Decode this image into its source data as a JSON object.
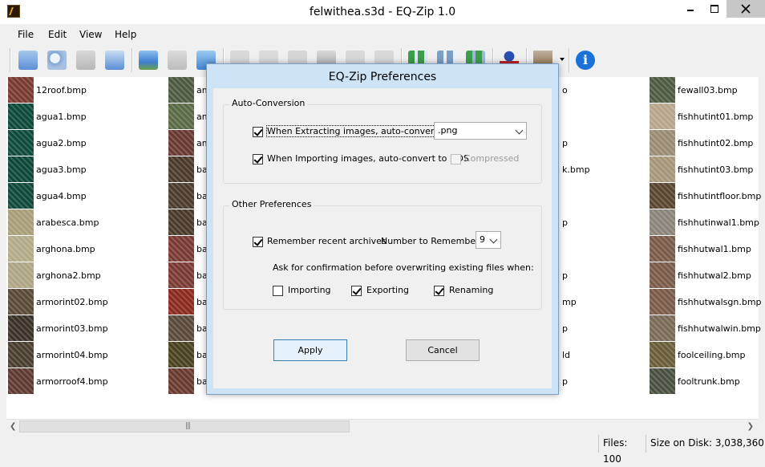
{
  "window": {
    "title": "felwithea.s3d - EQ-Zip 1.0",
    "controls": {
      "minimize_icon": "minimize-icon",
      "maximize_icon": "maximize-icon",
      "close_icon": "close-icon"
    }
  },
  "menu": {
    "items": [
      {
        "label": "File",
        "mnemonic": "F"
      },
      {
        "label": "Edit",
        "mnemonic": "E"
      },
      {
        "label": "View",
        "mnemonic": "V"
      },
      {
        "label": "Help",
        "mnemonic": "H"
      }
    ]
  },
  "toolbar": {
    "buttons": [
      {
        "icon": "new-archive-icon",
        "color": "#5b8fd6"
      },
      {
        "icon": "open-archive-icon",
        "color": "#7fa6d8"
      },
      {
        "icon": "save-archive-icon",
        "color": "#b8b8b8"
      },
      {
        "icon": "save-as-icon",
        "color": "#5b8fd6"
      },
      {
        "icon": "import-images-icon",
        "color": "#3f7fcf"
      },
      {
        "icon": "extract-images-icon",
        "color": "#bcbcbc"
      },
      {
        "icon": "extract-all-icon",
        "color": "#3f86d6"
      },
      {
        "icon": "cut-icon",
        "color": "#c8c8c8"
      },
      {
        "icon": "copy-icon",
        "color": "#c8c8c8"
      },
      {
        "icon": "paste-icon",
        "color": "#c8c8c8"
      },
      {
        "icon": "delete-icon",
        "color": "#b8b8b8"
      },
      {
        "icon": "rename-icon",
        "color": "#c8c8c8"
      },
      {
        "icon": "properties-icon",
        "color": "#c8c8c8"
      },
      {
        "icon": "select-all-icon",
        "color": "#3c9e4a"
      },
      {
        "icon": "select-none-icon",
        "color": "#7aa0c8"
      },
      {
        "icon": "invert-selection-icon",
        "color": "#3c9e4a"
      },
      {
        "icon": "preferences-icon",
        "color": "#2a4fb0"
      },
      {
        "icon": "thumbnail-size-icon",
        "color": "#8a6a40"
      },
      {
        "icon": "about-icon",
        "color": "#1a72d8"
      }
    ]
  },
  "files": {
    "column1": [
      {
        "name": "12roof.bmp",
        "color": "#7a3a32"
      },
      {
        "name": "agua1.bmp",
        "color": "#0e4a3a"
      },
      {
        "name": "agua2.bmp",
        "color": "#0f4b3c"
      },
      {
        "name": "agua3.bmp",
        "color": "#0d4838"
      },
      {
        "name": "agua4.bmp",
        "color": "#0f4a3b"
      },
      {
        "name": "arabesca.bmp",
        "color": "#a89e7a"
      },
      {
        "name": "arghona.bmp",
        "color": "#b3aa88"
      },
      {
        "name": "arghona2.bmp",
        "color": "#aea585"
      },
      {
        "name": "armorint02.bmp",
        "color": "#5a4a38"
      },
      {
        "name": "armorint03.bmp",
        "color": "#3a3128"
      },
      {
        "name": "armorint04.bmp",
        "color": "#4a3e30"
      },
      {
        "name": "armorroof4.bmp",
        "color": "#5e3a30"
      }
    ],
    "column2": [
      {
        "name": "am",
        "color": "#4e5a40"
      },
      {
        "name": "am",
        "color": "#5b6a46"
      },
      {
        "name": "am",
        "color": "#6a3a32"
      },
      {
        "name": "ba",
        "color": "#4a3a2a"
      },
      {
        "name": "ba",
        "color": "#4c3c2c"
      },
      {
        "name": "ba",
        "color": "#4a3a2a"
      },
      {
        "name": "ba",
        "color": "#7a3a34"
      },
      {
        "name": "ba",
        "color": "#7a3a34"
      },
      {
        "name": "ba",
        "color": "#8a2a20"
      },
      {
        "name": "ba",
        "color": "#5a4a3a"
      },
      {
        "name": "ba",
        "color": "#4a4220"
      },
      {
        "name": "ba",
        "color": "#6a3a30"
      }
    ],
    "column3": [
      {
        "name": "o",
        "color": ""
      },
      {
        "name": "",
        "color": ""
      },
      {
        "name": "p",
        "color": ""
      },
      {
        "name": "k.bmp",
        "color": ""
      },
      {
        "name": "",
        "color": ""
      },
      {
        "name": "p",
        "color": ""
      },
      {
        "name": "",
        "color": ""
      },
      {
        "name": "p",
        "color": ""
      },
      {
        "name": "mp",
        "color": ""
      },
      {
        "name": "p",
        "color": ""
      },
      {
        "name": "ld",
        "color": ""
      },
      {
        "name": "p",
        "color": ""
      }
    ],
    "column4": [
      {
        "name": "fewall03.bmp",
        "color": "#4e5a42"
      },
      {
        "name": "fishhutint01.bmp",
        "color": "#b8a48a"
      },
      {
        "name": "fishhutint02.bmp",
        "color": "#9a8c74"
      },
      {
        "name": "fishhutint03.bmp",
        "color": "#a8967a"
      },
      {
        "name": "fishhutintfloor.bmp",
        "color": "#5a4630"
      },
      {
        "name": "fishhutinwal1.bmp",
        "color": "#8a8478"
      },
      {
        "name": "fishhutwal1.bmp",
        "color": "#7a5a48"
      },
      {
        "name": "fishhutwal2.bmp",
        "color": "#7a5a48"
      },
      {
        "name": "fishhutwalsgn.bmp",
        "color": "#7a5a48"
      },
      {
        "name": "fishhutwalwin.bmp",
        "color": "#7a6a58"
      },
      {
        "name": "foolceiling.bmp",
        "color": "#6a5e3a"
      },
      {
        "name": "fooltrunk.bmp",
        "color": "#4a5040"
      }
    ]
  },
  "status": {
    "files": "Files: 100",
    "size": "Size on Disk: 3,038,360"
  },
  "dialog": {
    "title": "EQ-Zip Preferences",
    "auto_conversion": {
      "group_label": "Auto-Conversion",
      "extract_label": "When Extracting images, auto-convert to",
      "extract_checked": true,
      "format_value": ".png",
      "import_label": "When Importing images, auto-convert to DDS",
      "import_checked": true,
      "compressed_label": "Compressed",
      "compressed_checked": false
    },
    "other": {
      "group_label": "Other Preferences",
      "remember_label": "Remember recent archives",
      "remember_checked": true,
      "number_label": "Number to Remember:",
      "number_value": "9",
      "confirm_label": "Ask for confirmation before overwriting existing files when:",
      "importing_label": "Importing",
      "importing_checked": false,
      "exporting_label": "Exporting",
      "exporting_checked": true,
      "renaming_label": "Renaming",
      "renaming_checked": true
    },
    "apply_label": "Apply",
    "cancel_label": "Cancel"
  }
}
